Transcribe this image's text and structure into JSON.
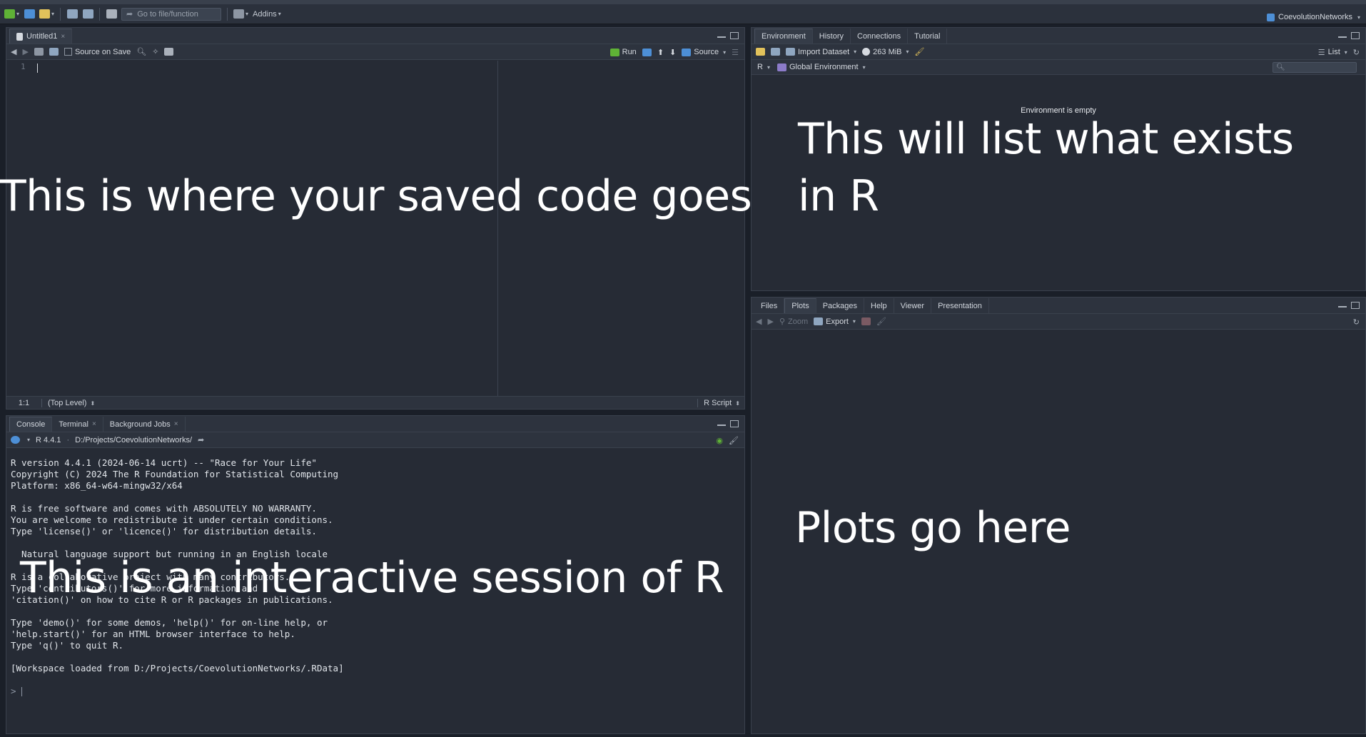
{
  "topbar": {
    "goto_placeholder": "Go to file/function",
    "addins_label": "Addins",
    "project_name": "CoevolutionNetworks"
  },
  "source_pane": {
    "tab_label": "Untitled1",
    "source_on_save_label": "Source on Save",
    "run_label": "Run",
    "source_label": "Source",
    "line_number": "1",
    "cursor_position": "1:1",
    "scope_label": "(Top Level)",
    "file_type": "R Script",
    "overlay_text": "This is where your saved code goes"
  },
  "console_pane": {
    "tabs": [
      {
        "label": "Console"
      },
      {
        "label": "Terminal"
      },
      {
        "label": "Background Jobs"
      }
    ],
    "r_version": "R 4.4.1",
    "working_dir": "D:/Projects/CoevolutionNetworks/",
    "output_lines": [
      "R version 4.4.1 (2024-06-14 ucrt) -- \"Race for Your Life\"",
      "Copyright (C) 2024 The R Foundation for Statistical Computing",
      "Platform: x86_64-w64-mingw32/x64",
      "",
      "R is free software and comes with ABSOLUTELY NO WARRANTY.",
      "You are welcome to redistribute it under certain conditions.",
      "Type 'license()' or 'licence()' for distribution details.",
      "",
      "  Natural language support but running in an English locale",
      "",
      "R is a collaborative project with many contributors.",
      "Type 'contributors()' for more information and",
      "'citation()' on how to cite R or R packages in publications.",
      "",
      "Type 'demo()' for some demos, 'help()' for on-line help, or",
      "'help.start()' for an HTML browser interface to help.",
      "Type 'q()' to quit R.",
      "",
      "[Workspace loaded from D:/Projects/CoevolutionNetworks/.RData]",
      ""
    ],
    "prompt": ">",
    "overlay_text": "This is an interactive session of R"
  },
  "env_pane": {
    "tabs": [
      {
        "label": "Environment"
      },
      {
        "label": "History"
      },
      {
        "label": "Connections"
      },
      {
        "label": "Tutorial"
      }
    ],
    "import_label": "Import Dataset",
    "memory_label": "263 MiB",
    "list_label": "List",
    "lang_label": "R",
    "scope_label": "Global Environment",
    "empty_message": "Environment is empty",
    "overlay_line1": "This will list what exists",
    "overlay_line2": "in R"
  },
  "files_pane": {
    "tabs": [
      {
        "label": "Files"
      },
      {
        "label": "Plots"
      },
      {
        "label": "Packages"
      },
      {
        "label": "Help"
      },
      {
        "label": "Viewer"
      },
      {
        "label": "Presentation"
      }
    ],
    "zoom_label": "Zoom",
    "export_label": "Export",
    "overlay_text": "Plots go here"
  },
  "colors": {
    "accent_green": "#5fb236",
    "accent_blue": "#4d8fd6",
    "accent_yellow": "#e2c25b"
  }
}
